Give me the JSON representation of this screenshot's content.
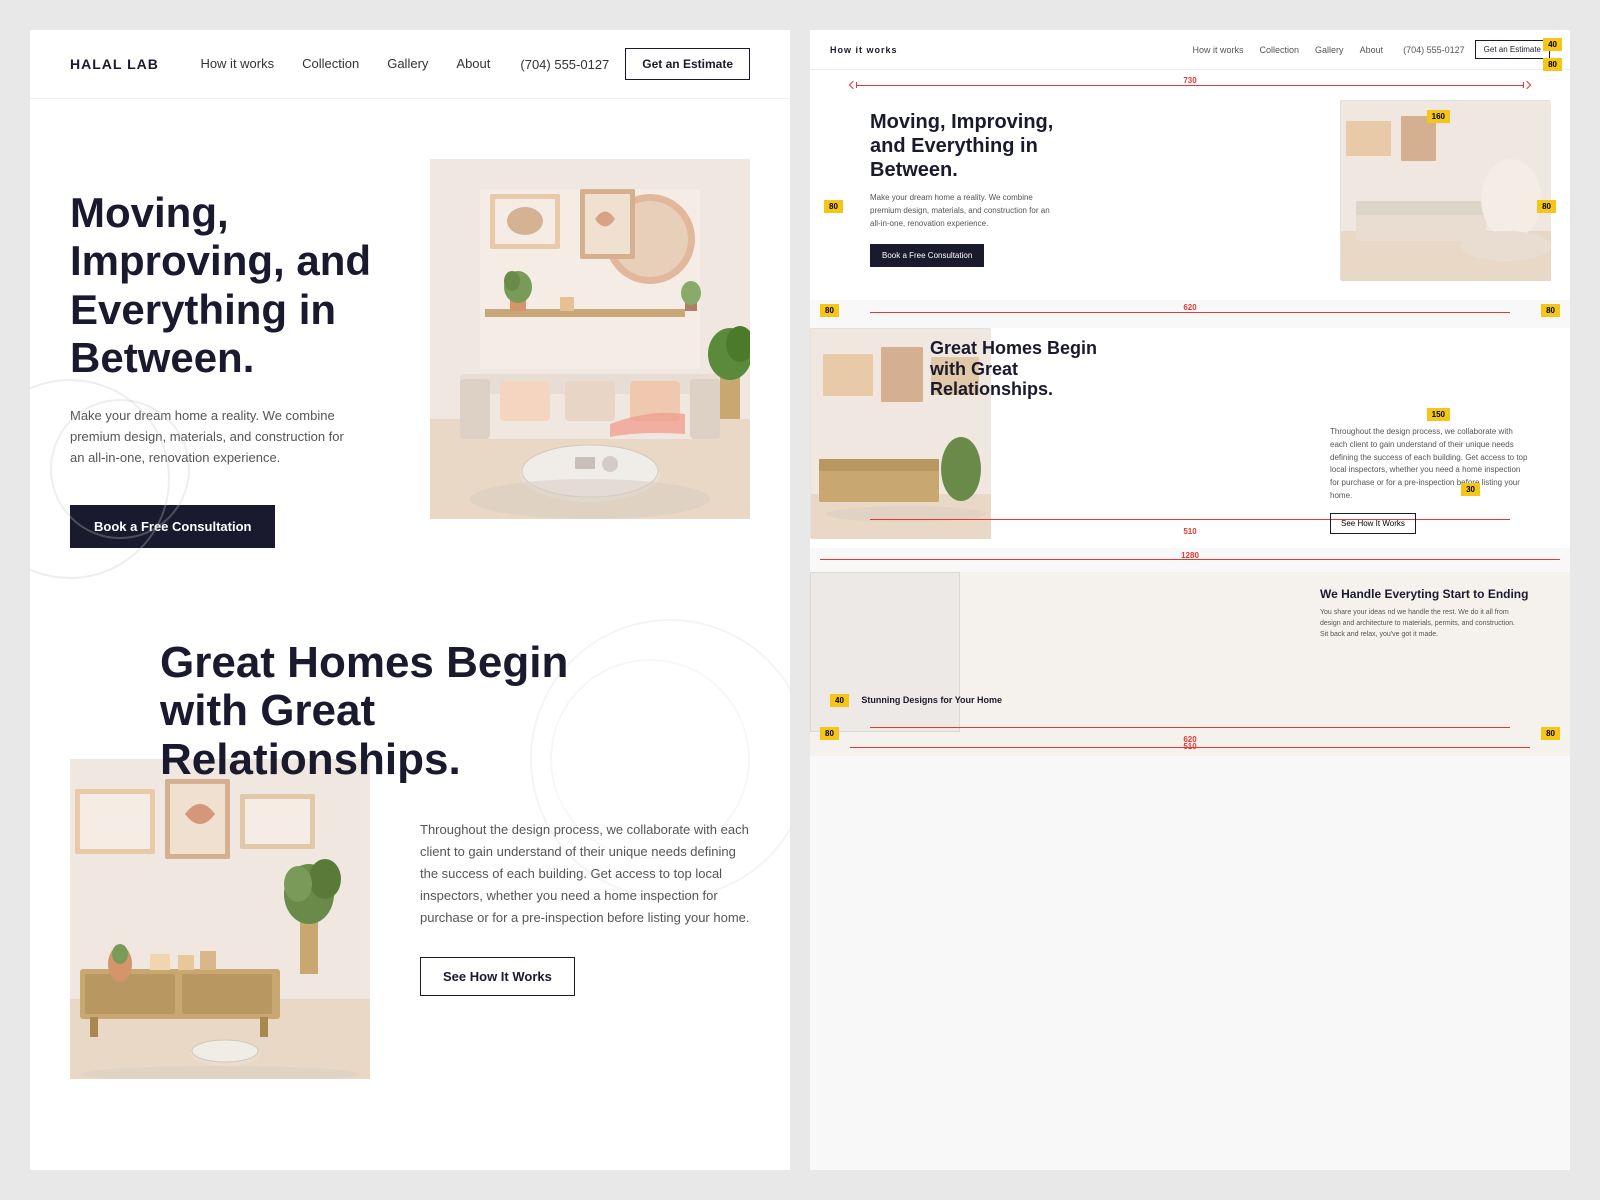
{
  "brand": {
    "name": "HALAL LAB"
  },
  "nav": {
    "links": [
      {
        "label": "How it works",
        "href": "#"
      },
      {
        "label": "Collection",
        "href": "#"
      },
      {
        "label": "Gallery",
        "href": "#"
      },
      {
        "label": "About",
        "href": "#"
      }
    ],
    "phone": "(704) 555-0127",
    "cta_label": "Get an Estimate"
  },
  "hero": {
    "title": "Moving, Improving, and Everything in Between.",
    "subtitle": "Make your dream home a reality. We combine premium design, materials, and construction for an all-in-one, renovation experience.",
    "cta_label": "Book a Free Consultation"
  },
  "section2": {
    "title": "Great Homes Begin with Great Relationships.",
    "body": "Throughout the design process, we collaborate with each client to gain understand of their unique needs defining the success of each building. Get access to top local inspectors, whether you need a home inspection for purchase or for a pre-inspection before listing your home.",
    "cta_label": "See How It Works"
  },
  "spec": {
    "nav": {
      "links": [
        "How it works",
        "Collection",
        "Gallery",
        "About"
      ],
      "phone": "(704) 555-0127",
      "cta_label": "Get an Estimate"
    },
    "hero": {
      "title": "Moving, Improving, and Everything in Between.",
      "subtitle": "Make your dream home a reality. We combine premium design, materials, and construction for an all-in-one, renovation experience.",
      "cta_label": "Book a Free Consultation"
    },
    "section2": {
      "title": "Great Homes Begin with Great Relationships.",
      "body": "Throughout the design process, we collaborate with each client to gain understand of their unique needs defining the success of each building. Get access to top local inspectors, whether you need a home inspection for purchase or for a pre-inspection before listing your home.",
      "cta_label": "See How It Works"
    },
    "section3": {
      "title": "We Handle Everyting Start to Ending",
      "body": "You share your ideas nd we handle the rest. We do it all from design and architecture to materials, permits, and construction. Sit back and relax, you've got it made.",
      "sub_title": "Stunning Designs for Your Home"
    },
    "measurements": {
      "total_width": "730",
      "left_margin": "80",
      "right_margin": "80",
      "content_width": "620",
      "bottom_width": "1280",
      "val_160": "160",
      "val_150": "150",
      "val_510": "510",
      "val_30": "30"
    }
  }
}
